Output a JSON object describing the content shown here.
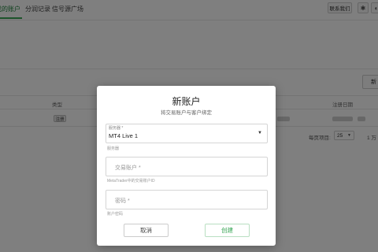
{
  "nav": {
    "tabs": [
      "我的账户",
      "分润记录",
      "信号源广场"
    ],
    "contact_label": "联系我们",
    "settings_icon": "gear-icon",
    "extra_icon": "circle-icon"
  },
  "table": {
    "side_button_label": "新",
    "columns": [
      "类型",
      "注册日期"
    ],
    "row": {
      "type_badge": "注册"
    },
    "per_page_label": "每页项目:",
    "per_page_value": "25",
    "pager_text": "1 万"
  },
  "dialog": {
    "title": "新账户",
    "subtitle": "将交易账户与客户绑定",
    "server": {
      "label": "服务器 *",
      "value": "MT4 Live 1",
      "help": "服务器"
    },
    "account": {
      "placeholder": "交易账户 *",
      "help": "MetaTrader中的交易账户ID"
    },
    "password": {
      "placeholder": "密码 *",
      "help": "账户密码"
    },
    "cancel_label": "取消",
    "create_label": "创建"
  },
  "colors": {
    "accent": "#3aa757",
    "overlay": "rgba(0,0,0,0.5)"
  }
}
